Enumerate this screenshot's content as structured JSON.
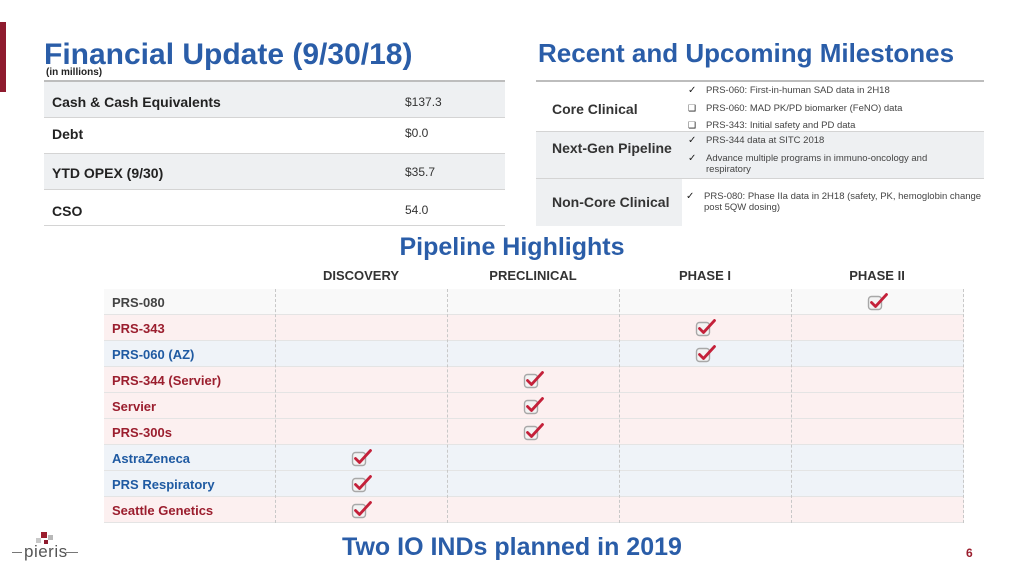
{
  "financial": {
    "title": "Financial Update (9/30/18)",
    "subtitle": "(in millions)",
    "rows": [
      {
        "label": "Cash & Cash Equivalents",
        "value": "$137.3"
      },
      {
        "label": "Debt",
        "value": "$0.0"
      },
      {
        "label": "YTD OPEX (9/30)",
        "value": "$35.7"
      },
      {
        "label": "CSO",
        "value": "54.0"
      }
    ]
  },
  "milestones": {
    "title": "Recent and Upcoming Milestones",
    "core": {
      "category": "Core Clinical",
      "items": [
        {
          "mark": "✓",
          "text": "PRS-060: First-in-human SAD data in 2H18"
        },
        {
          "mark": "❑",
          "text": "PRS-060: MAD PK/PD biomarker (FeNO) data"
        },
        {
          "mark": "❑",
          "text": "PRS-343: Initial safety and PD data"
        }
      ]
    },
    "nextgen": {
      "category": "Next-Gen Pipeline",
      "items": [
        {
          "mark": "✓",
          "text": "PRS-344 data at SITC 2018"
        },
        {
          "mark": "✓",
          "text": "Advance multiple programs in immuno-oncology and respiratory"
        }
      ]
    },
    "noncore": {
      "category": "Non-Core Clinical",
      "items": [
        {
          "mark": "✓",
          "text": "PRS-080: Phase IIa data in 2H18 (safety, PK, hemoglobin change post 5QW dosing)"
        }
      ]
    }
  },
  "pipeline": {
    "title": "Pipeline Highlights",
    "phases": [
      "DISCOVERY",
      "PRECLINICAL",
      "PHASE I",
      "PHASE II"
    ],
    "programs": [
      {
        "name": "PRS-080",
        "stage": 4,
        "name_color": "dark"
      },
      {
        "name": "PRS-343",
        "stage": 3,
        "name_color": "red"
      },
      {
        "name": "PRS-060 (AZ)",
        "stage": 3,
        "name_color": "blue"
      },
      {
        "name": "PRS-344 (Servier)",
        "stage": 2,
        "name_color": "red"
      },
      {
        "name": "Servier",
        "stage": 2,
        "name_color": "red"
      },
      {
        "name": "PRS-300s",
        "stage": 2,
        "name_color": "red"
      },
      {
        "name": "AstraZeneca",
        "stage": 1,
        "name_color": "blue"
      },
      {
        "name": "PRS Respiratory",
        "stage": 1,
        "name_color": "blue"
      },
      {
        "name": "Seattle Genetics",
        "stage": 1,
        "name_color": "red"
      }
    ],
    "check_icon": "checkmark-icon",
    "check_color": "#c4213a"
  },
  "footer": {
    "logo_text": "pieris",
    "headline": "Two IO INDs planned in 2019",
    "page_number": "6"
  },
  "colors": {
    "title_blue": "#2a5da8",
    "accent_red": "#8e1b2e",
    "program_red": "#9b1e2e",
    "program_blue": "#1f5aa2"
  }
}
